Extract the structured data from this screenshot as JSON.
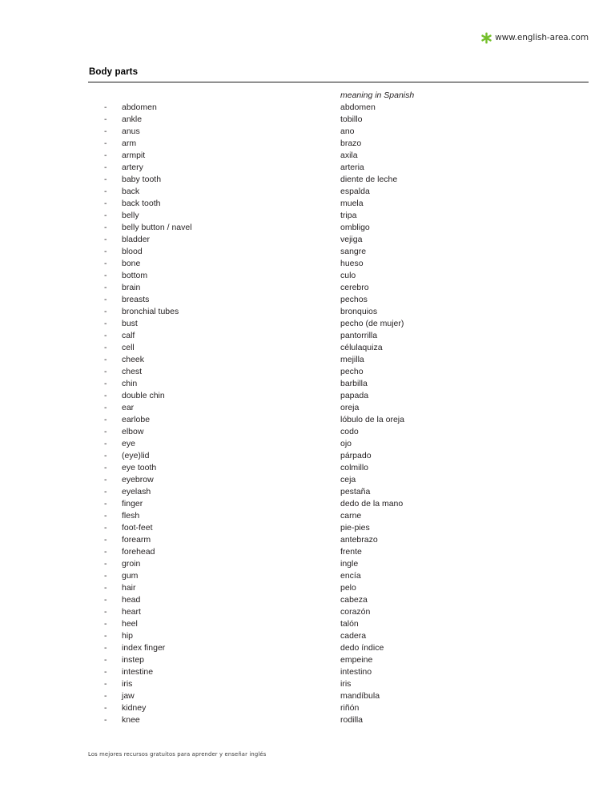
{
  "header": {
    "logo_icon": "green-asterisk-icon",
    "logo_color": "#74bf2b",
    "site_url": "www.english-area.com"
  },
  "title": "Body parts",
  "columns": {
    "english_header": "",
    "spanish_header": "meaning in Spanish"
  },
  "bullet": "-",
  "rows": [
    {
      "en": "abdomen",
      "sp": "abdomen"
    },
    {
      "en": "ankle",
      "sp": "tobillo"
    },
    {
      "en": "anus",
      "sp": "ano"
    },
    {
      "en": "arm",
      "sp": "brazo"
    },
    {
      "en": "armpit",
      "sp": "axila"
    },
    {
      "en": "artery",
      "sp": "arteria"
    },
    {
      "en": "baby tooth",
      "sp": "diente de leche"
    },
    {
      "en": "back",
      "sp": "espalda"
    },
    {
      "en": "back tooth",
      "sp": "muela"
    },
    {
      "en": "belly",
      "sp": "tripa"
    },
    {
      "en": "belly button / navel",
      "sp": "ombligo"
    },
    {
      "en": "bladder",
      "sp": "vejiga"
    },
    {
      "en": "blood",
      "sp": "sangre"
    },
    {
      "en": "bone",
      "sp": "hueso"
    },
    {
      "en": "bottom",
      "sp": "culo"
    },
    {
      "en": "brain",
      "sp": "cerebro"
    },
    {
      "en": "breasts",
      "sp": "pechos"
    },
    {
      "en": "bronchial tubes",
      "sp": "bronquios"
    },
    {
      "en": "bust",
      "sp": "pecho (de mujer)"
    },
    {
      "en": "calf",
      "sp": "pantorrilla"
    },
    {
      "en": "cell",
      "sp": "célulaquiza"
    },
    {
      "en": "cheek",
      "sp": "mejilla"
    },
    {
      "en": "chest",
      "sp": "pecho"
    },
    {
      "en": "chin",
      "sp": "barbilla"
    },
    {
      "en": "double chin",
      "sp": "papada"
    },
    {
      "en": "ear",
      "sp": "oreja"
    },
    {
      "en": "earlobe",
      "sp": "lóbulo de la oreja"
    },
    {
      "en": "elbow",
      "sp": "codo"
    },
    {
      "en": "eye",
      "sp": "ojo"
    },
    {
      "en": "(eye)lid",
      "sp": "párpado"
    },
    {
      "en": "eye tooth",
      "sp": "colmillo"
    },
    {
      "en": "eyebrow",
      "sp": "ceja"
    },
    {
      "en": "eyelash",
      "sp": "pestaña"
    },
    {
      "en": "finger",
      "sp": "dedo de la mano"
    },
    {
      "en": "flesh",
      "sp": "carne"
    },
    {
      "en": "foot-feet",
      "sp": "pie-pies"
    },
    {
      "en": "forearm",
      "sp": "antebrazo"
    },
    {
      "en": "forehead",
      "sp": "frente"
    },
    {
      "en": "groin",
      "sp": "ingle"
    },
    {
      "en": "gum",
      "sp": "encía"
    },
    {
      "en": "hair",
      "sp": "pelo"
    },
    {
      "en": "head",
      "sp": "cabeza"
    },
    {
      "en": "heart",
      "sp": "corazón"
    },
    {
      "en": "heel",
      "sp": "talón"
    },
    {
      "en": "hip",
      "sp": "cadera"
    },
    {
      "en": "index finger",
      "sp": "dedo índice"
    },
    {
      "en": "instep",
      "sp": "empeine"
    },
    {
      "en": "intestine",
      "sp": "intestino"
    },
    {
      "en": "iris",
      "sp": "iris"
    },
    {
      "en": "jaw",
      "sp": "mandíbula"
    },
    {
      "en": "kidney",
      "sp": "riñón"
    },
    {
      "en": "knee",
      "sp": "rodilla"
    }
  ],
  "footer": "Los mejores recursos gratuitos para aprender y enseñar inglés"
}
